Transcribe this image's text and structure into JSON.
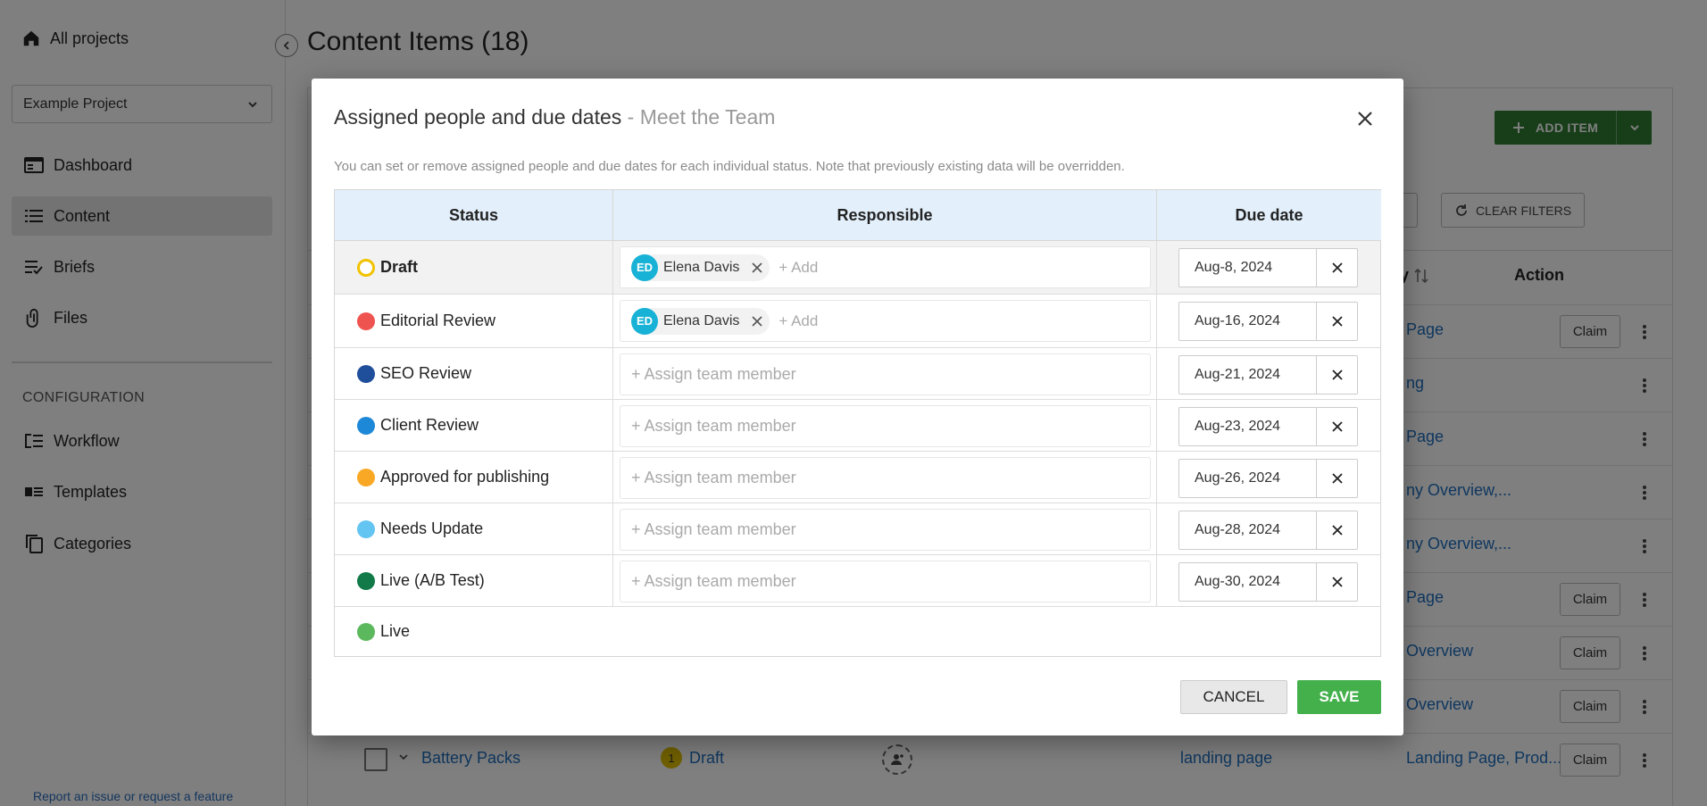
{
  "sidebar": {
    "all_projects": "All projects",
    "project": "Example Project",
    "items": [
      {
        "label": "Dashboard",
        "icon": "dashboard-icon"
      },
      {
        "label": "Content",
        "icon": "list-icon"
      },
      {
        "label": "Briefs",
        "icon": "brief-icon"
      },
      {
        "label": "Files",
        "icon": "paperclip-icon"
      }
    ],
    "config_heading": "CONFIGURATION",
    "config_items": [
      {
        "label": "Workflow",
        "icon": "workflow-icon"
      },
      {
        "label": "Templates",
        "icon": "templates-icon"
      },
      {
        "label": "Categories",
        "icon": "copy-icon"
      }
    ],
    "report_link": "Report an issue or request a feature"
  },
  "main": {
    "title": "Content Items (18)",
    "add_item": "ADD ITEM",
    "clear_filters": "CLEAR FILTERS",
    "col_category_fragment": "y",
    "col_action": "Action",
    "rows": [
      {
        "category": "Page",
        "claim": "Claim"
      },
      {
        "category": "ng",
        "claim": ""
      },
      {
        "category": "Page",
        "claim": ""
      },
      {
        "category": "ny Overview,...",
        "claim": ""
      },
      {
        "category": "ny Overview,...",
        "claim": ""
      },
      {
        "category": "Page",
        "claim": "Claim"
      },
      {
        "category": "Overview",
        "claim": "Claim"
      },
      {
        "category": "Overview",
        "claim": "Claim"
      }
    ],
    "battery_row": {
      "name": "Battery Packs",
      "status_num": "1",
      "status": "Draft",
      "type": "landing page",
      "category": "Landing Page, Prod...",
      "claim": "Claim"
    }
  },
  "modal": {
    "title": "Assigned people and due dates",
    "subtitle": "- Meet the Team",
    "note": "You can set or remove assigned people and due dates for each individual status. Note that previously existing data will be overridden.",
    "headers": {
      "status": "Status",
      "responsible": "Responsible",
      "due": "Due date"
    },
    "add_label": "+ Add",
    "assign_placeholder": "+ Assign team member",
    "rows": [
      {
        "status": "Draft",
        "color": "#f2c200",
        "assignee": {
          "initials": "ED",
          "name": "Elena Davis"
        },
        "due": "Aug-8, 2024"
      },
      {
        "status": "Editorial Review",
        "color": "#ef5350",
        "assignee": {
          "initials": "ED",
          "name": "Elena Davis"
        },
        "due": "Aug-16, 2024"
      },
      {
        "status": "SEO Review",
        "color": "#1f4e9b",
        "due": "Aug-21, 2024"
      },
      {
        "status": "Client Review",
        "color": "#1e88d8",
        "due": "Aug-23, 2024"
      },
      {
        "status": "Approved for publishing",
        "color": "#f9a825",
        "due": "Aug-26, 2024"
      },
      {
        "status": "Needs Update",
        "color": "#64c4f2",
        "due": "Aug-28, 2024"
      },
      {
        "status": "Live (A/B Test)",
        "color": "#117a48",
        "due": "Aug-30, 2024"
      },
      {
        "status": "Live",
        "color": "#5cb85c"
      }
    ],
    "cancel": "CANCEL",
    "save": "SAVE"
  }
}
